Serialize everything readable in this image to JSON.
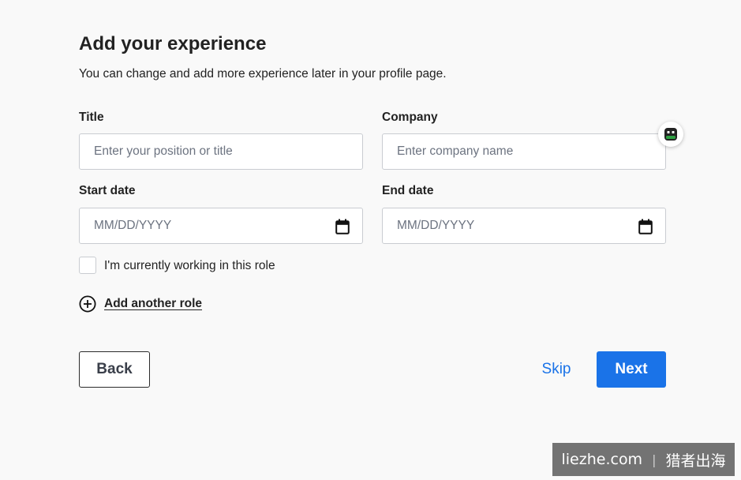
{
  "form": {
    "heading": "Add your experience",
    "subtitle": "You can change and add more experience later in your profile page.",
    "title_field": {
      "label": "Title",
      "value": "",
      "placeholder": "Enter your position or title"
    },
    "company_field": {
      "label": "Company",
      "value": "",
      "placeholder": "Enter company name"
    },
    "start_date_field": {
      "label": "Start date",
      "value": "",
      "placeholder": "MM/DD/YYYY",
      "icon": "calendar-icon"
    },
    "end_date_field": {
      "label": "End date",
      "value": "",
      "placeholder": "MM/DD/YYYY",
      "icon": "calendar-icon"
    },
    "current_role_checkbox": {
      "label": "I'm currently working in this role",
      "checked": false
    },
    "add_role": {
      "label": "Add another role",
      "icon": "plus-circle-icon"
    }
  },
  "actions": {
    "back_label": "Back",
    "skip_label": "Skip",
    "next_label": "Next"
  },
  "widget": {
    "icon": "robot-assistant-icon"
  },
  "watermark": {
    "site": "liezhe.com",
    "separator": "|",
    "brand": "猎者出海"
  },
  "colors": {
    "background": "#f9f9f9",
    "primary": "#1a73e8",
    "border": "#c9ccd1",
    "text": "#222222",
    "placeholder": "#6c7380",
    "widget_accent": "#2ea043"
  }
}
